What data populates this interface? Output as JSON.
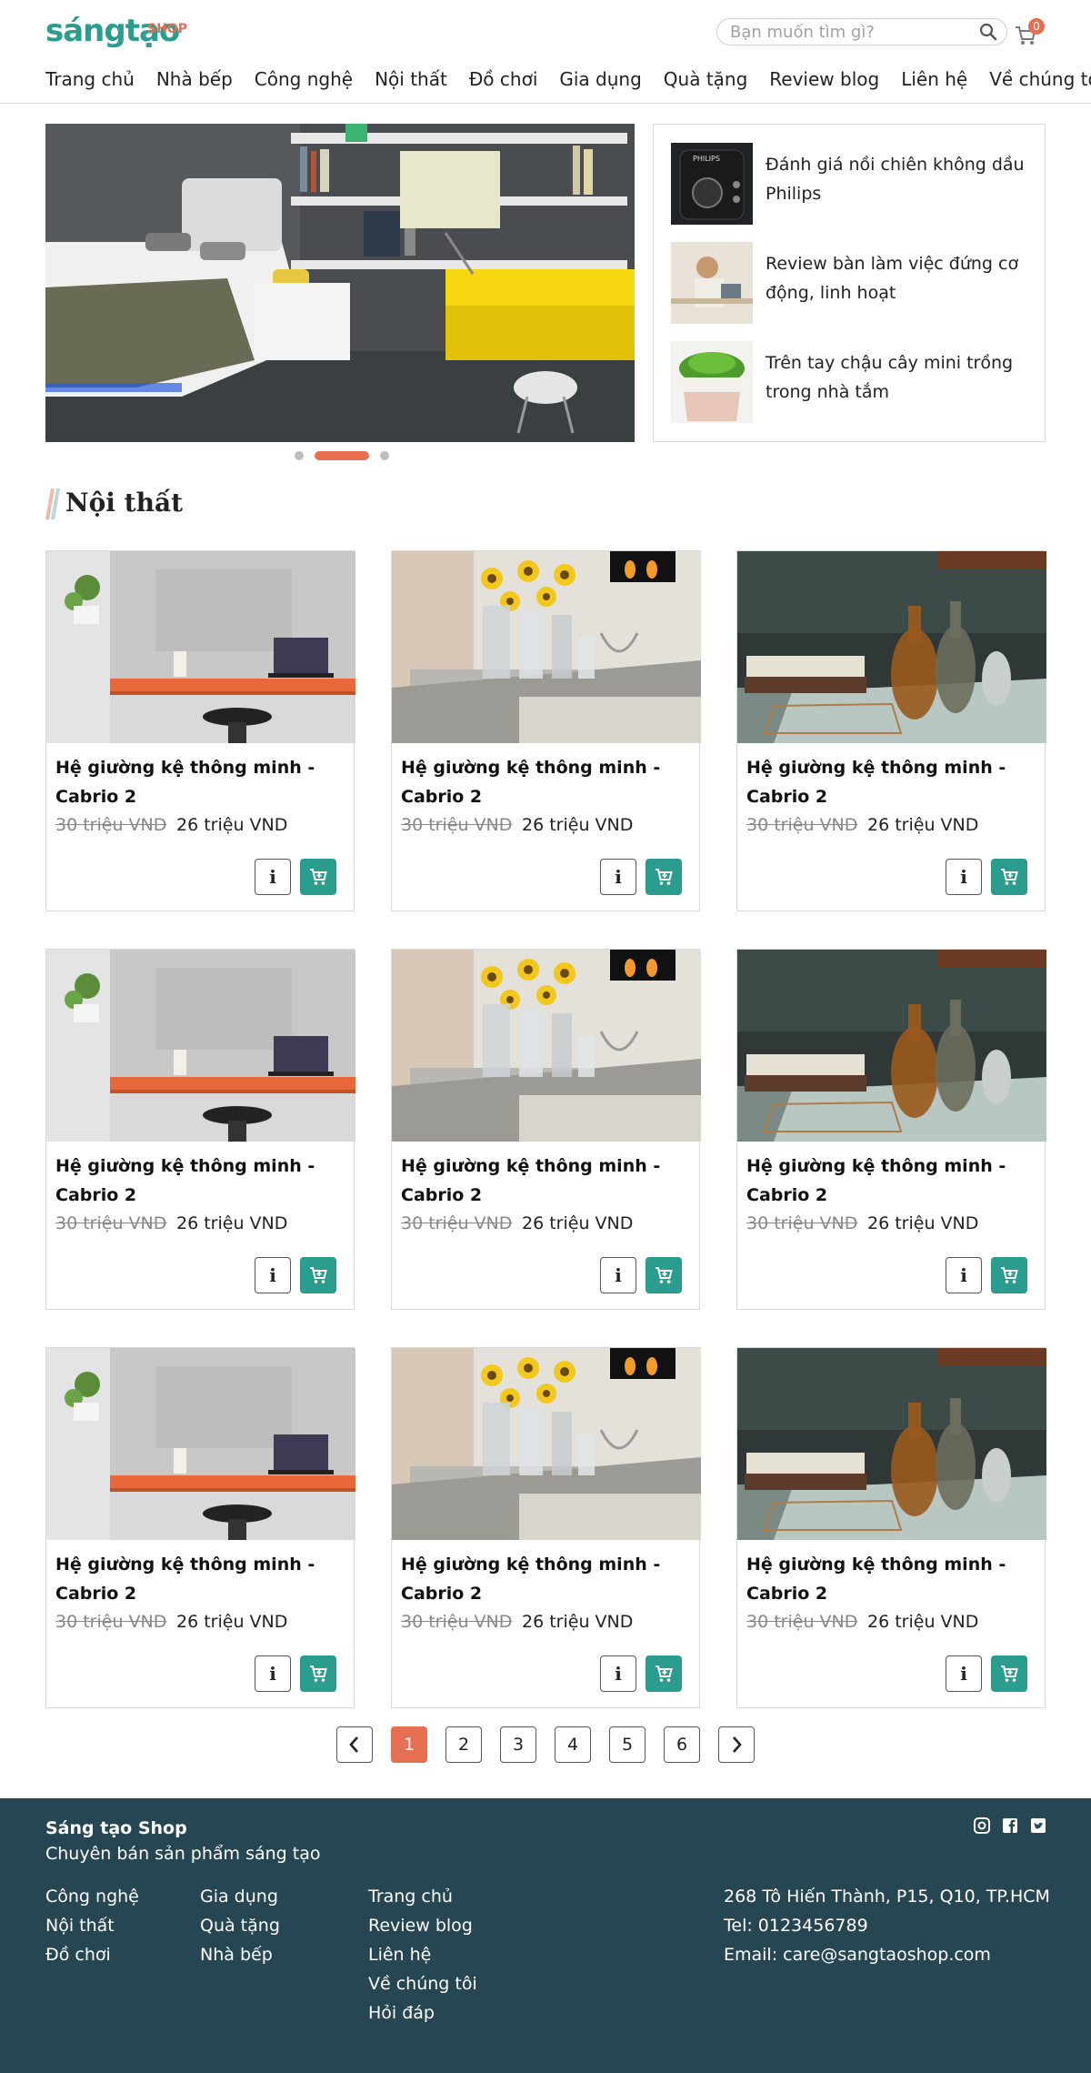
{
  "header": {
    "logo_main": "sángtạo",
    "logo_shop": "SHOP",
    "search_placeholder": "Bạn muốn tìm gì?",
    "cart_count": "0",
    "nav": [
      "Trang chủ",
      "Nhà bếp",
      "Công nghệ",
      "Nội thất",
      "Đồ chơi",
      "Gia dụng",
      "Quà tặng",
      "Review blog",
      "Liên hệ",
      "Về chúng tôi"
    ]
  },
  "slider": {
    "active_index": 1,
    "count": 3
  },
  "side_posts": [
    {
      "title": "Đánh giá nồi chiên không dầu Philips",
      "thumb_text": "PHILIPS"
    },
    {
      "title": "Review bàn làm việc đứng cơ động, linh hoạt"
    },
    {
      "title": "Trên tay chậu cây mini trồng trong nhà tắm"
    }
  ],
  "section": {
    "title": "Nội thất"
  },
  "products": [
    {
      "name": "Hệ giường kệ thông minh - Cabrio 2",
      "old_price": "30 triệu VND",
      "new_price": "26 triệu VND",
      "image": "desk"
    },
    {
      "name": "Hệ giường kệ thông minh - Cabrio 2",
      "old_price": "30 triệu VND",
      "new_price": "26 triệu VND",
      "image": "flowers"
    },
    {
      "name": "Hệ giường kệ thông minh - Cabrio 2",
      "old_price": "30 triệu VND",
      "new_price": "26 triệu VND",
      "image": "bottles"
    },
    {
      "name": "Hệ giường kệ thông minh - Cabrio 2",
      "old_price": "30 triệu VND",
      "new_price": "26 triệu VND",
      "image": "desk"
    },
    {
      "name": "Hệ giường kệ thông minh - Cabrio 2",
      "old_price": "30 triệu VND",
      "new_price": "26 triệu VND",
      "image": "flowers"
    },
    {
      "name": "Hệ giường kệ thông minh - Cabrio 2",
      "old_price": "30 triệu VND",
      "new_price": "26 triệu VND",
      "image": "bottles"
    },
    {
      "name": "Hệ giường kệ thông minh - Cabrio 2",
      "old_price": "30 triệu VND",
      "new_price": "26 triệu VND",
      "image": "desk"
    },
    {
      "name": "Hệ giường kệ thông minh - Cabrio 2",
      "old_price": "30 triệu VND",
      "new_price": "26 triệu VND",
      "image": "flowers"
    },
    {
      "name": "Hệ giường kệ thông minh - Cabrio 2",
      "old_price": "30 triệu VND",
      "new_price": "26 triệu VND",
      "image": "bottles"
    }
  ],
  "product_buttons": {
    "info_label": "i"
  },
  "pagination": {
    "pages": [
      "1",
      "2",
      "3",
      "4",
      "5",
      "6"
    ],
    "active": "1"
  },
  "footer": {
    "brand": "Sáng tạo Shop",
    "tagline": "Chuyên bán sản phẩm sáng tạo",
    "col1": [
      "Công nghệ",
      "Nội thất",
      "Đồ chơi"
    ],
    "col2": [
      "Gia dụng",
      "Quà tặng",
      "Nhà bếp"
    ],
    "col3": [
      "Trang chủ",
      "Review blog",
      "Liên hệ",
      "Về chúng tôi",
      "Hỏi đáp"
    ],
    "address": "268 Tô Hiến Thành, P15, Q10, TP.HCM",
    "phone": "Tel: 0123456789",
    "email": "Email: care@sangtaoshop.com",
    "social_icons": [
      "instagram-icon",
      "facebook-icon",
      "twitter-icon"
    ]
  },
  "colors": {
    "primary": "#2a9d8f",
    "accent": "#e76f51",
    "footer_bg": "#264653"
  }
}
